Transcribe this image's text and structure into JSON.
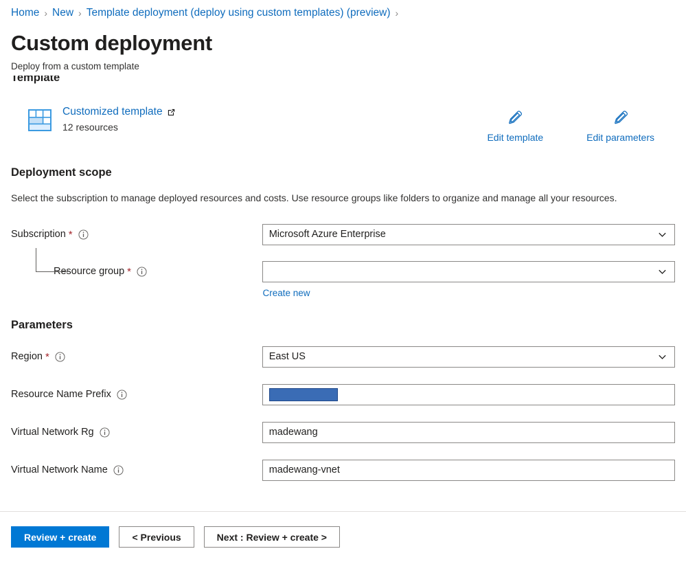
{
  "breadcrumb": {
    "items": [
      {
        "label": "Home"
      },
      {
        "label": "New"
      },
      {
        "label": "Template deployment (deploy using custom templates) (preview)"
      }
    ],
    "separator": "›"
  },
  "page": {
    "title": "Custom deployment",
    "subtitle": "Deploy from a custom template"
  },
  "template_section": {
    "heading": "Template",
    "link_label": "Customized template",
    "resource_count": "12 resources",
    "edit_template_label": "Edit template",
    "edit_parameters_label": "Edit parameters"
  },
  "deployment_scope": {
    "heading": "Deployment scope",
    "description": "Select the subscription to manage deployed resources and costs. Use resource groups like folders to organize and manage all your resources.",
    "subscription": {
      "label": "Subscription",
      "required": "*",
      "value": "Microsoft Azure Enterprise"
    },
    "resource_group": {
      "label": "Resource group",
      "required": "*",
      "value": "",
      "create_new_label": "Create new"
    }
  },
  "parameters": {
    "heading": "Parameters",
    "fields": [
      {
        "label": "Region",
        "required": "*",
        "type": "select",
        "value": "East US"
      },
      {
        "label": "Resource Name Prefix",
        "required": "",
        "type": "text",
        "value": "",
        "selected": true
      },
      {
        "label": "Virtual Network Rg",
        "required": "",
        "type": "text",
        "value": "madewang"
      },
      {
        "label": "Virtual Network Name",
        "required": "",
        "type": "text",
        "value": "madewang-vnet"
      }
    ]
  },
  "footer": {
    "review_create_label": "Review + create",
    "previous_label": "< Previous",
    "next_label": "Next : Review + create >"
  },
  "colors": {
    "link": "#0f6cbd",
    "primary_button": "#0078d4",
    "required_asterisk": "#a4262c",
    "selection_fill": "#3a6cb5",
    "border": "#8a8886"
  }
}
